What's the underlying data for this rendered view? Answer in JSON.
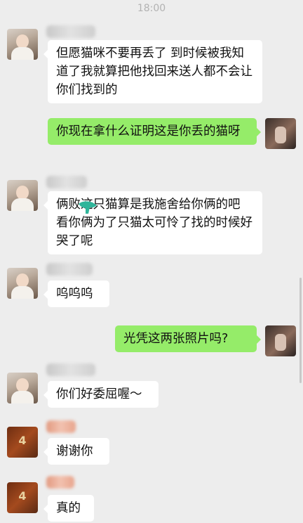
{
  "status": {
    "time": "18:00"
  },
  "messages": [
    {
      "side": "left",
      "avatar": "avatar-girl",
      "text": "但愿猫咪不要再丢了 到时候被我知道了我就算把他找回来送人都不会让你们找到的"
    },
    {
      "side": "right",
      "avatar": "avatar-self",
      "text": "你现在拿什么证明这是你丢的猫呀"
    },
    {
      "side": "left",
      "avatar": "avatar-girl",
      "text": "俩败这只猫算是我施舍给你俩的吧 看你俩为了只猫太可怜了找的时候好哭了呢",
      "sticker": "hand-sticker-icon"
    },
    {
      "side": "left",
      "avatar": "avatar-girl",
      "text": "呜呜呜"
    },
    {
      "side": "right",
      "avatar": "avatar-self",
      "text": "光凭这两张照片吗?"
    },
    {
      "side": "left",
      "avatar": "avatar-girl",
      "text": "你们好委屈喔～"
    },
    {
      "side": "left",
      "avatar": "avatar-brown",
      "text": "谢谢你"
    },
    {
      "side": "left",
      "avatar": "avatar-brown",
      "text": "真的"
    }
  ],
  "colors": {
    "background": "#ededed",
    "self_bubble": "#95ec69",
    "other_bubble": "#ffffff"
  }
}
